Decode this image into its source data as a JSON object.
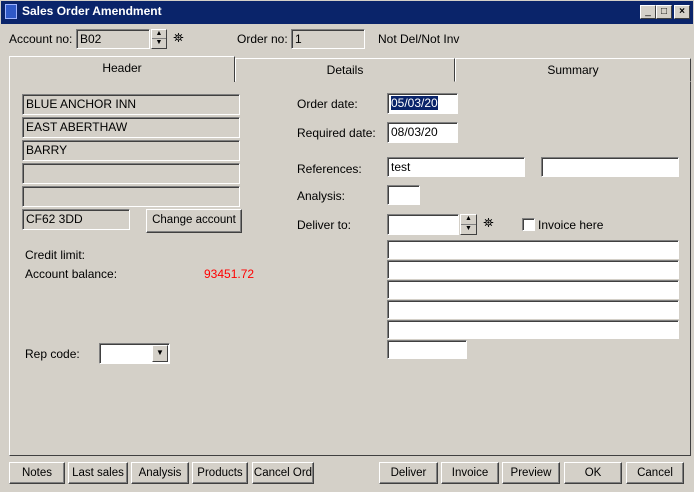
{
  "window": {
    "title": "Sales Order Amendment"
  },
  "top": {
    "account_label": "Account no:",
    "account_value": "B02",
    "order_label": "Order no:",
    "order_value": "1",
    "status": "Not Del/Not Inv"
  },
  "tabs": [
    {
      "label": "Header"
    },
    {
      "label": "Details"
    },
    {
      "label": "Summary"
    }
  ],
  "address": {
    "lines": [
      "BLUE ANCHOR INN",
      "EAST ABERTHAW",
      "BARRY",
      "",
      ""
    ],
    "postcode": "CF62 3DD"
  },
  "change_account_label": "Change account",
  "credit": {
    "credit_limit_label": "Credit limit:",
    "credit_limit_value": "",
    "balance_label": "Account balance:",
    "balance_value": "93451.72",
    "balance_color": "#ff0000"
  },
  "rep": {
    "label": "Rep code:",
    "value": ""
  },
  "order": {
    "order_date_label": "Order date:",
    "order_date": "05/03/20",
    "required_date_label": "Required date:",
    "required_date": "08/03/20",
    "references_label": "References:",
    "reference_1": "test",
    "reference_2": "",
    "analysis_label": "Analysis:",
    "analysis_value": "",
    "deliver_to_label": "Deliver to:",
    "deliver_to_value": "",
    "invoice_here_label": "Invoice here",
    "delivery_lines": [
      "",
      "",
      "",
      "",
      "",
      ""
    ]
  },
  "footer": {
    "left": [
      "Notes",
      "Last sales",
      "Analysis",
      "Products",
      "Cancel Ord"
    ],
    "right": [
      "Deliver",
      "Invoice",
      "Preview",
      "OK",
      "Cancel"
    ]
  },
  "icons": {
    "find": "binoculars-icon",
    "spin": "spinner-icon",
    "combo": "dropdown-arrow-icon"
  }
}
